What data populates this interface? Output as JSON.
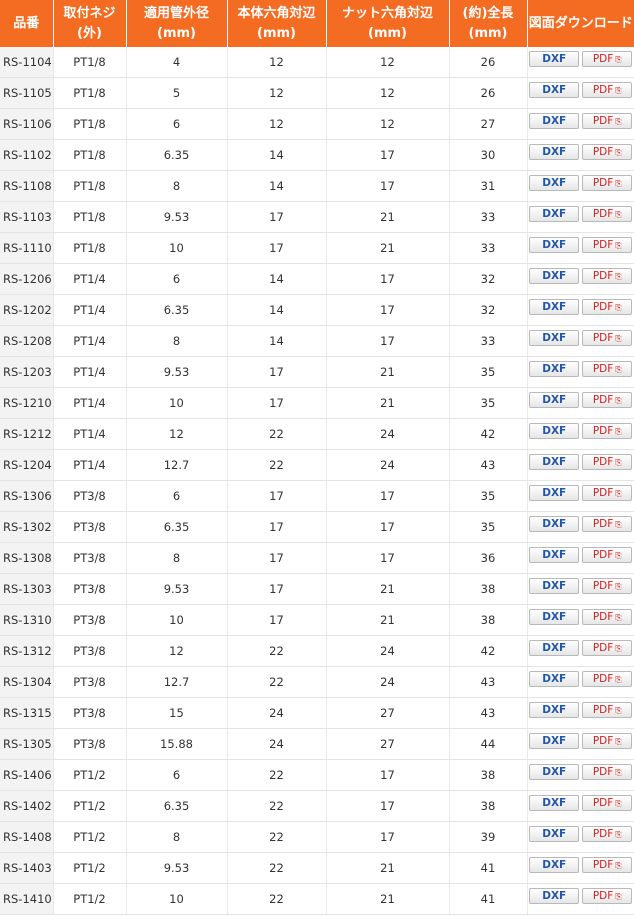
{
  "headers": [
    "品番",
    "取付ネジ\n(外)",
    "適用管外径\n(mm)",
    "本体六角対辺\n(mm)",
    "ナット六角対辺\n(mm)",
    "(約)全長\n(mm)",
    "図面ダウンロード"
  ],
  "buttons": {
    "dxf": "DXF",
    "pdf": "PDF",
    "pdf_icon": "⎘"
  },
  "rows": [
    [
      "RS-1104",
      "PT1/8",
      "4",
      "12",
      "12",
      "26"
    ],
    [
      "RS-1105",
      "PT1/8",
      "5",
      "12",
      "12",
      "26"
    ],
    [
      "RS-1106",
      "PT1/8",
      "6",
      "12",
      "12",
      "27"
    ],
    [
      "RS-1102",
      "PT1/8",
      "6.35",
      "14",
      "17",
      "30"
    ],
    [
      "RS-1108",
      "PT1/8",
      "8",
      "14",
      "17",
      "31"
    ],
    [
      "RS-1103",
      "PT1/8",
      "9.53",
      "17",
      "21",
      "33"
    ],
    [
      "RS-1110",
      "PT1/8",
      "10",
      "17",
      "21",
      "33"
    ],
    [
      "RS-1206",
      "PT1/4",
      "6",
      "14",
      "17",
      "32"
    ],
    [
      "RS-1202",
      "PT1/4",
      "6.35",
      "14",
      "17",
      "32"
    ],
    [
      "RS-1208",
      "PT1/4",
      "8",
      "14",
      "17",
      "33"
    ],
    [
      "RS-1203",
      "PT1/4",
      "9.53",
      "17",
      "21",
      "35"
    ],
    [
      "RS-1210",
      "PT1/4",
      "10",
      "17",
      "21",
      "35"
    ],
    [
      "RS-1212",
      "PT1/4",
      "12",
      "22",
      "24",
      "42"
    ],
    [
      "RS-1204",
      "PT1/4",
      "12.7",
      "22",
      "24",
      "43"
    ],
    [
      "RS-1306",
      "PT3/8",
      "6",
      "17",
      "17",
      "35"
    ],
    [
      "RS-1302",
      "PT3/8",
      "6.35",
      "17",
      "17",
      "35"
    ],
    [
      "RS-1308",
      "PT3/8",
      "8",
      "17",
      "17",
      "36"
    ],
    [
      "RS-1303",
      "PT3/8",
      "9.53",
      "17",
      "21",
      "38"
    ],
    [
      "RS-1310",
      "PT3/8",
      "10",
      "17",
      "21",
      "38"
    ],
    [
      "RS-1312",
      "PT3/8",
      "12",
      "22",
      "24",
      "42"
    ],
    [
      "RS-1304",
      "PT3/8",
      "12.7",
      "22",
      "24",
      "43"
    ],
    [
      "RS-1315",
      "PT3/8",
      "15",
      "24",
      "27",
      "43"
    ],
    [
      "RS-1305",
      "PT3/8",
      "15.88",
      "24",
      "27",
      "44"
    ],
    [
      "RS-1406",
      "PT1/2",
      "6",
      "22",
      "17",
      "38"
    ],
    [
      "RS-1402",
      "PT1/2",
      "6.35",
      "22",
      "17",
      "38"
    ],
    [
      "RS-1408",
      "PT1/2",
      "8",
      "22",
      "17",
      "39"
    ],
    [
      "RS-1403",
      "PT1/2",
      "9.53",
      "22",
      "21",
      "41"
    ],
    [
      "RS-1410",
      "PT1/2",
      "10",
      "22",
      "21",
      "41"
    ]
  ]
}
